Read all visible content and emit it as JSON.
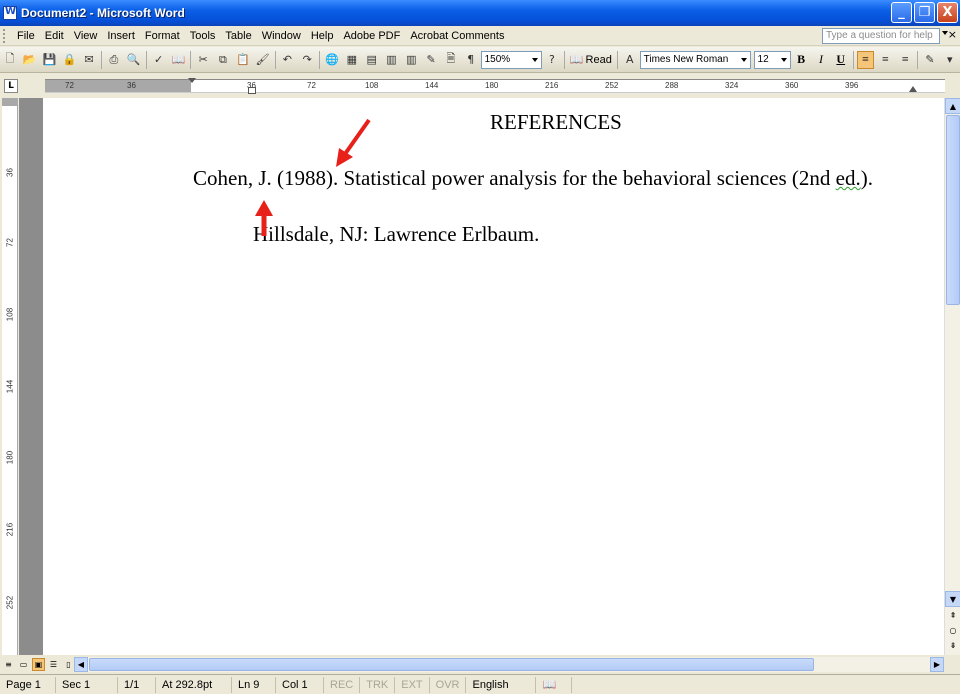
{
  "window": {
    "title": "Document2 - Microsoft Word",
    "minimize_glyph": "_",
    "maximize_glyph": "❐",
    "close_glyph": "X"
  },
  "menu": {
    "items": [
      "File",
      "Edit",
      "View",
      "Insert",
      "Format",
      "Tools",
      "Table",
      "Window",
      "Help",
      "Adobe PDF",
      "Acrobat Comments"
    ],
    "help_placeholder": "Type a question for help",
    "close_glyph": "×"
  },
  "toolbar": {
    "zoom": "150%",
    "read_label": "Read",
    "font_name": "Times New Roman",
    "font_size": "12",
    "bold": "B",
    "italic": "I",
    "underline": "U"
  },
  "ruler": {
    "h_ticks": [
      "72",
      "36",
      "36",
      "72",
      "108",
      "144",
      "180",
      "216",
      "252",
      "288",
      "324",
      "360",
      "396"
    ],
    "v_ticks": [
      "36",
      "72",
      "108",
      "144",
      "180",
      "216",
      "252"
    ],
    "tab_selector": "L"
  },
  "document": {
    "heading": "REFERENCES",
    "ref_line1_part1": "Cohen, J. (1988). Statistical power analysis for the behavioral sciences (2nd ",
    "ref_line1_squiggle": "ed.",
    "ref_line1_part2": ").",
    "ref_line2": "Hillsdale, NJ: Lawrence Erlbaum."
  },
  "annotation": {
    "arrow_color": "#E8201A"
  },
  "status": {
    "page": "Page 1",
    "section": "Sec 1",
    "pages": "1/1",
    "at": "At 292.8pt",
    "line": "Ln 9",
    "col": "Col 1",
    "rec": "REC",
    "trk": "TRK",
    "ext": "EXT",
    "ovr": "OVR",
    "language": "English (U.S."
  }
}
